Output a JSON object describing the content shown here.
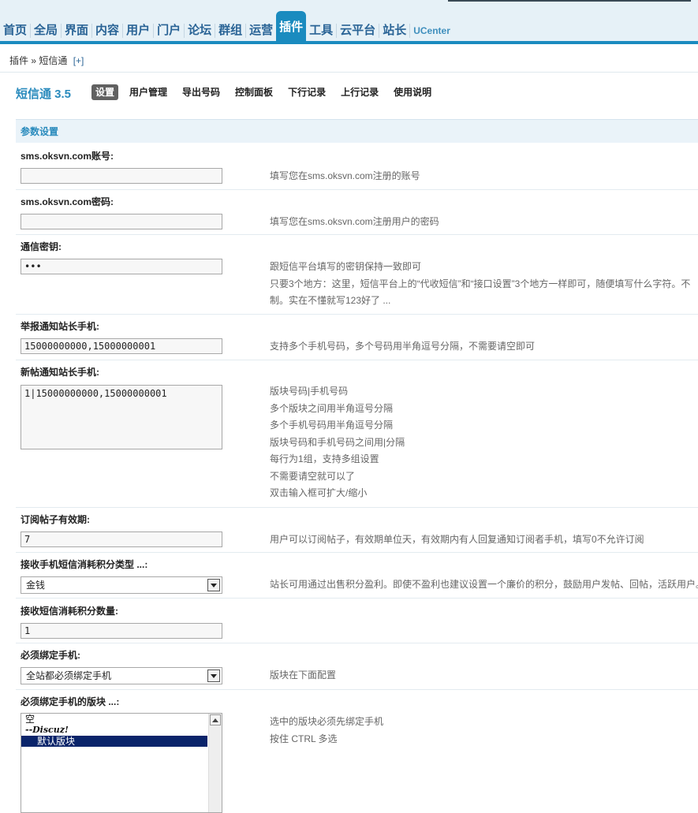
{
  "nav": [
    {
      "label": "首页"
    },
    {
      "label": "全局"
    },
    {
      "label": "界面"
    },
    {
      "label": "内容"
    },
    {
      "label": "用户"
    },
    {
      "label": "门户"
    },
    {
      "label": "论坛"
    },
    {
      "label": "群组"
    },
    {
      "label": "运营"
    },
    {
      "label": "插件",
      "active": true
    },
    {
      "label": "工具"
    },
    {
      "label": "云平台"
    },
    {
      "label": "站长"
    },
    {
      "label": "UCenter"
    }
  ],
  "breadcrumb": {
    "text": "插件 » 短信通",
    "plus": "[+]"
  },
  "plugin_title": "短信通 3.5",
  "tabs": [
    "设置",
    "用户管理",
    "导出号码",
    "控制面板",
    "下行记录",
    "上行记录",
    "使用说明"
  ],
  "section_title": "参数设置",
  "fields": {
    "account": {
      "label": "sms.oksvn.com账号:",
      "value": "",
      "tip": "填写您在sms.oksvn.com注册的账号"
    },
    "password": {
      "label": "sms.oksvn.com密码:",
      "value": "",
      "tip": "填写您在sms.oksvn.com注册用户的密码"
    },
    "secret": {
      "label": "通信密钥:",
      "value": "•••",
      "tips": [
        "跟短信平台填写的密钥保持一致即可",
        "只要3个地方：这里，短信平台上的“代收短信”和“接口设置”3个地方一样即可，随便填写什么字符。不",
        "制。实在不懂就写123好了 ..."
      ]
    },
    "report_phone": {
      "label": "举报通知站长手机:",
      "value": "15000000000,15000000001",
      "tip": "支持多个手机号码，多个号码用半角逗号分隔，不需要请空即可"
    },
    "newpost_phone": {
      "label": "新帖通知站长手机:",
      "value": "1|15000000000,15000000001",
      "tips": [
        "版块号码|手机号码",
        "多个版块之间用半角逗号分隔",
        "多个手机号码用半角逗号分隔",
        "版块号码和手机号码之间用|分隔",
        "每行为1组，支持多组设置",
        "不需要请空就可以了",
        "双击输入框可扩大/缩小"
      ]
    },
    "subscribe_days": {
      "label": "订阅帖子有效期:",
      "value": "7",
      "tip": "用户可以订阅帖子，有效期单位天，有效期内有人回复通知订阅者手机，填写0不允许订阅"
    },
    "credit_type": {
      "label": "接收手机短信消耗积分类型 ...:",
      "value": "金钱",
      "tip": "站长可用通过出售积分盈利。即使不盈利也建议设置一个廉价的积分，鼓励用户发帖、回帖，活跃用户。"
    },
    "credit_amount": {
      "label": "接收短信消耗积分数量:",
      "value": "1"
    },
    "must_bind": {
      "label": "必须绑定手机:",
      "value": "全站都必须绑定手机",
      "tip": "版块在下面配置"
    },
    "bind_forums": {
      "label": "必须绑定手机的版块 ...:",
      "options": [
        "空",
        "--Discuz!",
        "默认版块"
      ],
      "tips": [
        "选中的版块必须先绑定手机",
        "按住 CTRL 多选"
      ]
    }
  }
}
